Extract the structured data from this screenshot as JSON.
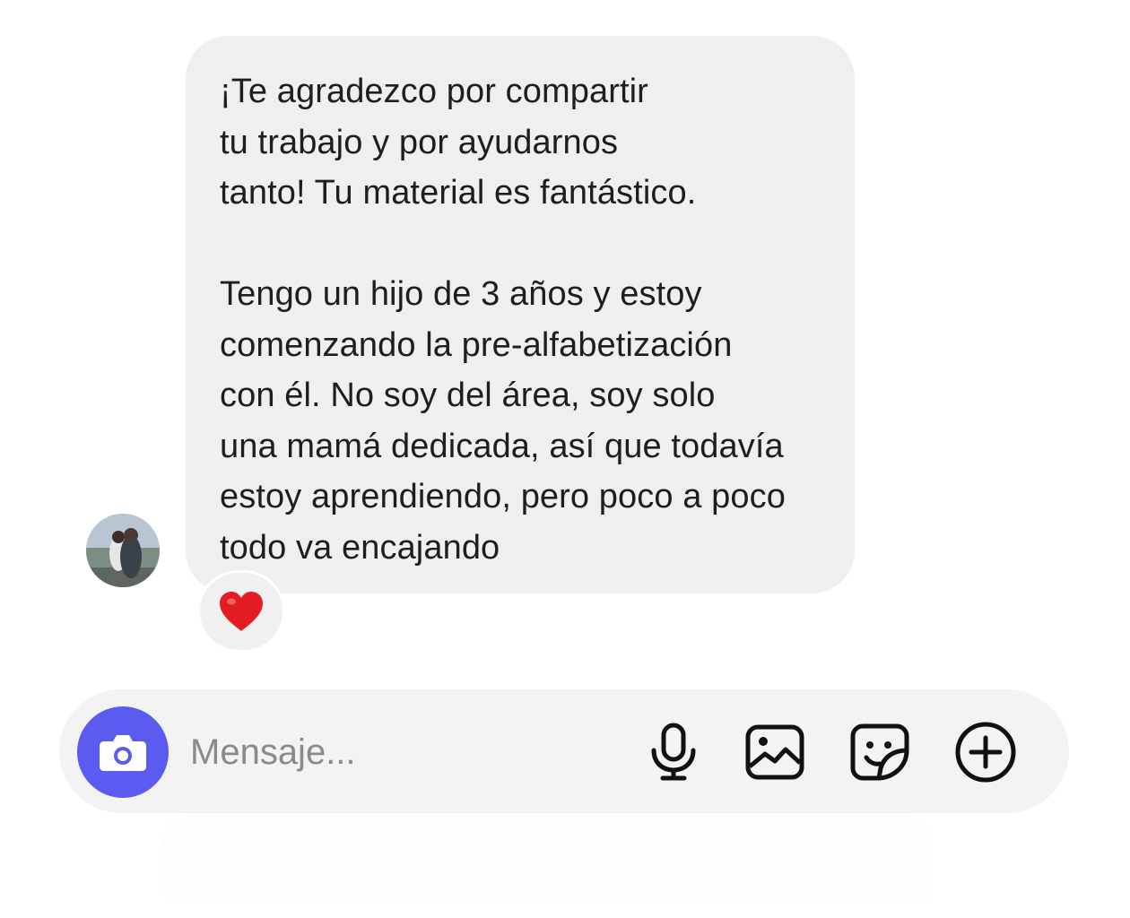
{
  "message": {
    "paragraphs": [
      [
        "¡Te agradezco por compartir",
        "tu trabajo y por ayudarnos",
        "tanto! Tu material es fantástico."
      ],
      [
        "Tengo un hijo de 3 años y estoy",
        "comenzando la pre-alfabetización",
        "con él. No soy del área, soy solo",
        "una mamá dedicada, así que todavía",
        "estoy aprendiendo, pero poco a poco",
        "todo va encajando"
      ]
    ],
    "reaction": "❤️"
  },
  "composer": {
    "placeholder": "Mensaje...",
    "accent_color": "#5b5bf0",
    "icons": [
      "camera-icon",
      "microphone-icon",
      "image-icon",
      "sticker-icon",
      "plus-icon"
    ]
  }
}
